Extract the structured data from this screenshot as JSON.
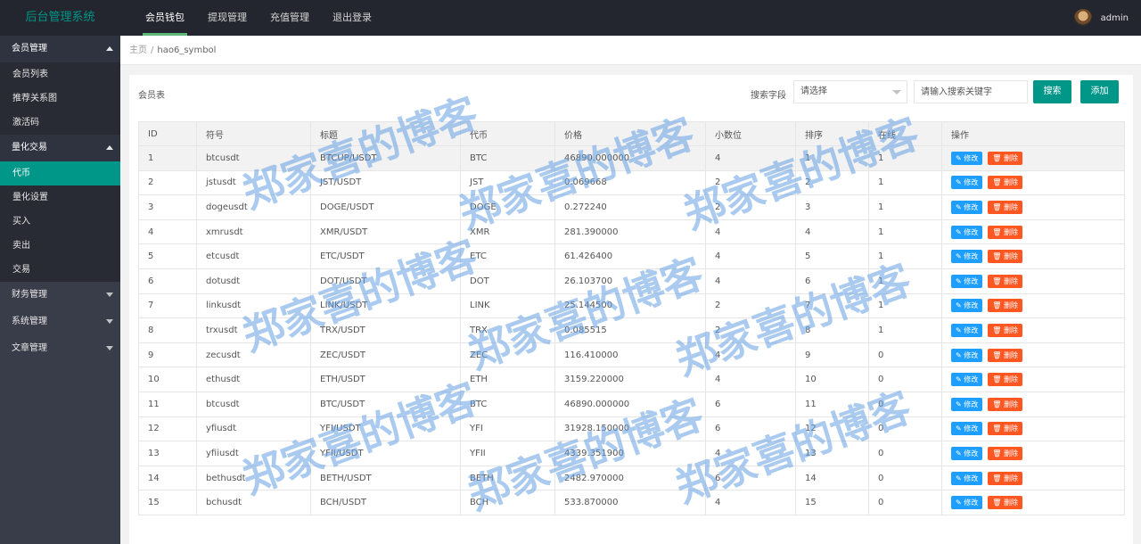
{
  "brand": "后台管理系统",
  "top_nav": [
    {
      "label": "会员钱包",
      "active": true
    },
    {
      "label": "提现管理",
      "active": false
    },
    {
      "label": "充值管理",
      "active": false
    },
    {
      "label": "退出登录",
      "active": false
    }
  ],
  "user": {
    "name": "admin"
  },
  "sidebar": {
    "groups": [
      {
        "label": "会员管理",
        "expanded": true,
        "items": [
          {
            "label": "会员列表"
          },
          {
            "label": "推荐关系图"
          },
          {
            "label": "激活码"
          }
        ]
      },
      {
        "label": "量化交易",
        "expanded": true,
        "items": [
          {
            "label": "代币",
            "active": true
          },
          {
            "label": "量化设置"
          },
          {
            "label": "买入"
          },
          {
            "label": "卖出"
          },
          {
            "label": "交易"
          }
        ]
      },
      {
        "label": "财务管理",
        "expanded": false
      },
      {
        "label": "系统管理",
        "expanded": false
      },
      {
        "label": "文章管理",
        "expanded": false
      }
    ]
  },
  "breadcrumb": {
    "home": "主页",
    "separator": "/",
    "current": "hao6_symbol"
  },
  "panel": {
    "title": "会员表",
    "search_field_label": "搜索字段",
    "select_value": "请选择",
    "keyword_placeholder": "请输入搜索关键字",
    "search_button": "搜索",
    "add_button": "添加"
  },
  "table": {
    "columns": [
      "ID",
      "符号",
      "标题",
      "代币",
      "价格",
      "小数位",
      "排序",
      "在线",
      "操作"
    ],
    "edit_label": "修改",
    "delete_label": "删除",
    "rows": [
      [
        "1",
        "btcusdt",
        "BTCUP/USDT",
        "BTC",
        "46890.000000",
        "4",
        "1",
        "1"
      ],
      [
        "2",
        "jstusdt",
        "JST/USDT",
        "JST",
        "0.069668",
        "2",
        "2",
        "1"
      ],
      [
        "3",
        "dogeusdt",
        "DOGE/USDT",
        "DOGE",
        "0.272240",
        "2",
        "3",
        "1"
      ],
      [
        "4",
        "xmrusdt",
        "XMR/USDT",
        "XMR",
        "281.390000",
        "4",
        "4",
        "1"
      ],
      [
        "5",
        "etcusdt",
        "ETC/USDT",
        "ETC",
        "61.426400",
        "4",
        "5",
        "1"
      ],
      [
        "6",
        "dotusdt",
        "DOT/USDT",
        "DOT",
        "26.103700",
        "4",
        "6",
        "1"
      ],
      [
        "7",
        "linkusdt",
        "LINK/USDT",
        "LINK",
        "25.144500",
        "2",
        "7",
        "1"
      ],
      [
        "8",
        "trxusdt",
        "TRX/USDT",
        "TRX",
        "0.085515",
        "2",
        "8",
        "1"
      ],
      [
        "9",
        "zecusdt",
        "ZEC/USDT",
        "ZEC",
        "116.410000",
        "4",
        "9",
        "0"
      ],
      [
        "10",
        "ethusdt",
        "ETH/USDT",
        "ETH",
        "3159.220000",
        "4",
        "10",
        "0"
      ],
      [
        "11",
        "btcusdt",
        "BTC/USDT",
        "BTC",
        "46890.000000",
        "6",
        "11",
        "0"
      ],
      [
        "12",
        "yfiusdt",
        "YFI/USDT",
        "YFI",
        "31928.150000",
        "6",
        "12",
        "0"
      ],
      [
        "13",
        "yfiiusdt",
        "YFII/USDT",
        "YFII",
        "4339.351900",
        "4",
        "13",
        "0"
      ],
      [
        "14",
        "bethusdt",
        "BETH/USDT",
        "BETH",
        "2482.970000",
        "6",
        "14",
        "0"
      ],
      [
        "15",
        "bchusdt",
        "BCH/USDT",
        "BCH",
        "533.870000",
        "4",
        "15",
        "0"
      ]
    ]
  },
  "watermark": "郑家喜的博客",
  "colors": {
    "accent": "#009688",
    "topbar": "#23262e",
    "sidebar": "#393d49",
    "edit": "#1e9fff",
    "delete": "#ff5722"
  }
}
